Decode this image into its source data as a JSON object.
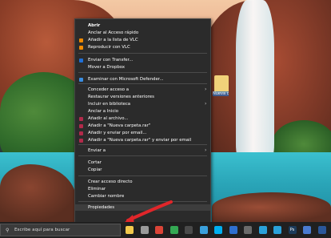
{
  "context_menu": {
    "items": [
      {
        "label": "Abrir",
        "bold": true,
        "icon": "",
        "color": ""
      },
      {
        "label": "Anclar al Acceso rápido",
        "icon": "",
        "color": ""
      },
      {
        "label": "Añadir a la lista de VLC",
        "icon": "vlc-icon",
        "color": "#f08a00"
      },
      {
        "label": "Reproducir con VLC",
        "icon": "vlc-icon",
        "color": "#f08a00"
      },
      {
        "label": "Enviar con Transfer...",
        "icon": "dropbox-icon",
        "color": "#1f6fd6"
      },
      {
        "label": "Mover a Dropbox",
        "icon": "",
        "color": ""
      },
      {
        "label": "Examinar con Microsoft Defender...",
        "icon": "defender-icon",
        "color": "#3a8de0"
      },
      {
        "label": "Conceder acceso a",
        "icon": "",
        "color": "",
        "submenu": true
      },
      {
        "label": "Restaurar versiones anteriores",
        "icon": "",
        "color": ""
      },
      {
        "label": "Incluir en biblioteca",
        "icon": "",
        "color": "",
        "submenu": true
      },
      {
        "label": "Anclar a Inicio",
        "icon": "",
        "color": ""
      },
      {
        "label": "Añadir al archivo...",
        "icon": "winrar-icon",
        "color": "#b22a4a"
      },
      {
        "label": "Añadir a \"Nueva carpeta.rar\"",
        "icon": "winrar-icon",
        "color": "#b22a4a"
      },
      {
        "label": "Añadir y enviar por email...",
        "icon": "winrar-icon",
        "color": "#b22a4a"
      },
      {
        "label": "Añadir a \"Nueva carpeta.rar\" y enviar por email",
        "icon": "winrar-icon",
        "color": "#b22a4a"
      },
      {
        "label": "Enviar a",
        "icon": "",
        "color": "",
        "submenu": true
      },
      {
        "label": "Cortar",
        "icon": "",
        "color": ""
      },
      {
        "label": "Copiar",
        "icon": "",
        "color": ""
      },
      {
        "label": "Crear acceso directo",
        "icon": "",
        "color": ""
      },
      {
        "label": "Eliminar",
        "icon": "",
        "color": ""
      },
      {
        "label": "Cambiar nombre",
        "icon": "",
        "color": ""
      },
      {
        "label": "Propiedades",
        "icon": "",
        "color": "",
        "highlighted": true
      }
    ]
  },
  "desktop": {
    "folder_label": "Nueva carpeta"
  },
  "taskbar": {
    "search_placeholder": "Escribe aquí para buscar",
    "icons": [
      {
        "name": "file-explorer-icon",
        "color": "#f2c94c"
      },
      {
        "name": "settings-icon",
        "color": "#9a9a9a"
      },
      {
        "name": "chrome-icon",
        "color": "#db4437"
      },
      {
        "name": "chrome-alt-icon",
        "color": "#34a853"
      },
      {
        "name": "circle-app-icon",
        "color": "#4a4a4a"
      },
      {
        "name": "edge-icon",
        "color": "#3aa0dc"
      },
      {
        "name": "skype-icon",
        "color": "#00aff0"
      },
      {
        "name": "mail-icon",
        "color": "#2f6fcf"
      },
      {
        "name": "app-icon",
        "color": "#6b6b6b"
      },
      {
        "name": "telegram-icon",
        "color": "#2aa1da"
      },
      {
        "name": "telegram-alt-icon",
        "color": "#2aa1da"
      },
      {
        "name": "photoshop-icon",
        "color": "#1c3b5a",
        "text": "Ps"
      },
      {
        "name": "app-blue-icon",
        "color": "#4a7bd0"
      },
      {
        "name": "word-icon",
        "color": "#2b579a"
      }
    ]
  },
  "annotation": {
    "arrow_color": "#e0262a"
  }
}
